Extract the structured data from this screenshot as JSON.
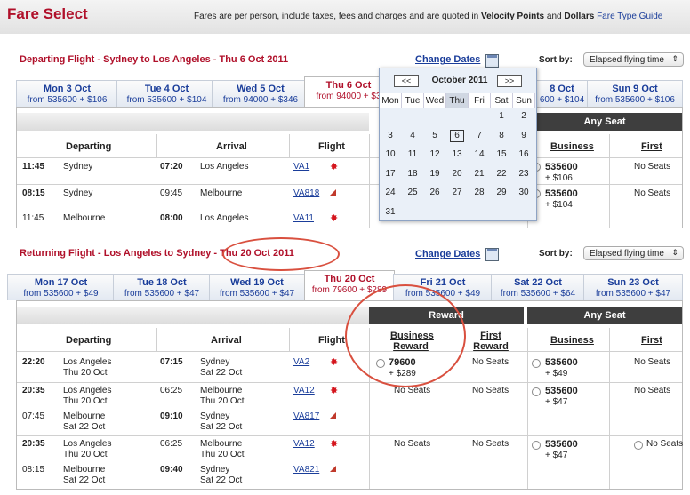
{
  "header": {
    "title": "Fare Select",
    "note_pre": "Fares are per person, include taxes, fees and charges and are quoted in",
    "note_vp": "Velocity Points",
    "note_and": "and",
    "note_d": "Dollars",
    "fare_type_link": "Fare Type Guide"
  },
  "departing": {
    "title": "Departing Flight - Sydney to Los Angeles - Thu 6 Oct 2011",
    "change_dates": "Change Dates",
    "sort_label": "Sort by:",
    "sort_value": "Elapsed flying time",
    "tabs": [
      {
        "date": "Mon 3 Oct",
        "price": "from 535600 + $106"
      },
      {
        "date": "Tue 4 Oct",
        "price": "from 535600 + $104"
      },
      {
        "date": "Wed 5 Oct",
        "price": "from 94000 + $346"
      },
      {
        "date": "Thu 6 Oct",
        "price": "from 94000 + $3"
      },
      {
        "date": "8 Oct",
        "price": "600 + $104"
      },
      {
        "date": "Sun 9 Oct",
        "price": "from 535600 + $106"
      }
    ],
    "headers": {
      "departing": "Departing",
      "arrival": "Arrival",
      "flight": "Flight",
      "any_seat": "Any Seat",
      "business": "Business",
      "first": "First"
    },
    "rows": [
      {
        "dep_time": "11:45",
        "dep_city": "Sydney",
        "arr_time": "07:20",
        "arr_city": "Los Angeles",
        "flight": "VA1",
        "business_pts": "535600",
        "business_cash": "+ $106",
        "first": "No Seats"
      },
      {
        "dep_time": "08:15",
        "dep_city": "Sydney",
        "arr_time": "09:45",
        "arr_city": "Melbourne",
        "flight": "VA818",
        "business_pts": "535600",
        "business_cash": "+ $104",
        "first": "No Seats"
      },
      {
        "dep_time": "11:45",
        "dep_city": "Melbourne",
        "arr_time": "08:00",
        "arr_city": "Los Angeles",
        "flight": "VA11"
      }
    ]
  },
  "calendar": {
    "prev": "<<",
    "next": ">>",
    "month": "October 2011",
    "weekdays": [
      "Mon",
      "Tue",
      "Wed",
      "Thu",
      "Fri",
      "Sat",
      "Sun"
    ],
    "weeks": [
      [
        "",
        "",
        "",
        "",
        "",
        "1",
        "2"
      ],
      [
        "3",
        "4",
        "5",
        "6",
        "7",
        "8",
        "9"
      ],
      [
        "10",
        "11",
        "12",
        "13",
        "14",
        "15",
        "16"
      ],
      [
        "17",
        "18",
        "19",
        "20",
        "21",
        "22",
        "23"
      ],
      [
        "24",
        "25",
        "26",
        "27",
        "28",
        "29",
        "30"
      ],
      [
        "31",
        "",
        "",
        "",
        "",
        "",
        ""
      ]
    ]
  },
  "returning": {
    "title_pre": "Returning Flight - Los Angeles to Sydney - ",
    "title_date": "Thu 20 Oct 2011",
    "change_dates": "Change Dates",
    "sort_label": "Sort by:",
    "sort_value": "Elapsed flying time",
    "tabs": [
      {
        "date": "Mon 17 Oct",
        "price": "from 535600 + $49"
      },
      {
        "date": "Tue 18 Oct",
        "price": "from 535600 + $47"
      },
      {
        "date": "Wed 19 Oct",
        "price": "from 535600 + $47"
      },
      {
        "date": "Thu 20 Oct",
        "price": "from 79600 + $289"
      },
      {
        "date": "Fri 21 Oct",
        "price": "from 535600 + $49"
      },
      {
        "date": "Sat 22 Oct",
        "price": "from 535600 + $64"
      },
      {
        "date": "Sun 23 Oct",
        "price": "from 535600 + $47"
      }
    ],
    "headers": {
      "reward": "Reward",
      "any_seat": "Any Seat",
      "departing": "Departing",
      "arrival": "Arrival",
      "flight": "Flight",
      "business_reward_1": "Business",
      "business_reward_2": "Reward",
      "first_reward_1": "First",
      "first_reward_2": "Reward",
      "business": "Business",
      "first": "First"
    },
    "rows": [
      {
        "dep_time": "22:20",
        "dep_city": "Los Angeles",
        "dep_date": "Thu 20 Oct",
        "arr_time": "07:15",
        "arr_city": "Sydney",
        "arr_date": "Sat 22 Oct",
        "flight": "VA2",
        "br_pts": "79600",
        "br_cash": "+ $289",
        "fr": "No Seats",
        "b_pts": "535600",
        "b_cash": "+ $49",
        "f": "No Seats"
      },
      {
        "dep_time": "20:35",
        "dep_city": "Los Angeles",
        "dep_date": "Thu 20 Oct",
        "arr_time": "06:25",
        "arr_city": "Melbourne",
        "arr_date": "Thu 20 Oct",
        "flight": "VA12",
        "br": "No Seats",
        "fr": "No Seats",
        "b_pts": "535600",
        "b_cash": "+ $47",
        "f": "No Seats",
        "dep2_time": "07:45",
        "dep2_city": "Melbourne",
        "dep2_date": "Sat 22 Oct",
        "arr2_time": "09:10",
        "arr2_city": "Sydney",
        "arr2_date": "Sat 22 Oct",
        "flight2": "VA817"
      },
      {
        "dep_time": "20:35",
        "dep_city": "Los Angeles",
        "dep_date": "Thu 20 Oct",
        "arr_time": "06:25",
        "arr_city": "Melbourne",
        "arr_date": "Thu 20 Oct",
        "flight": "VA12",
        "br": "No Seats",
        "fr": "No Seats",
        "b_pts": "535600",
        "b_cash": "+ $47",
        "f": "No Seats",
        "dep2_time": "08:15",
        "dep2_city": "Melbourne",
        "dep2_date": "Sat 22 Oct",
        "arr2_time": "09:40",
        "arr2_city": "Sydney",
        "arr2_date": "Sat 22 Oct",
        "flight2": "VA821"
      }
    ]
  }
}
